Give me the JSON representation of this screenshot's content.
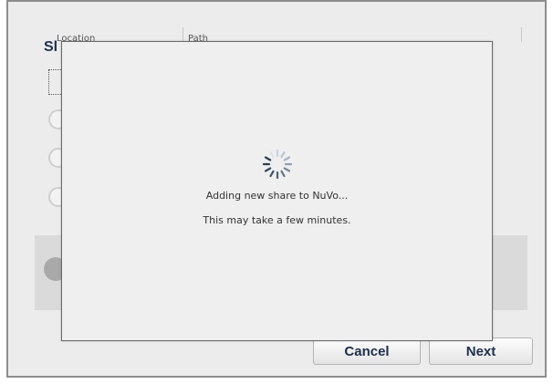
{
  "table": {
    "columns": [
      "Location",
      "Path"
    ]
  },
  "background": {
    "title_fragment": "Sl"
  },
  "buttons": {
    "cancel_label": "Cancel",
    "next_label": "Next"
  },
  "progress": {
    "message": "Adding new share to NuVo...",
    "detail": "This may take a few minutes.",
    "icon": "spinner-icon"
  }
}
